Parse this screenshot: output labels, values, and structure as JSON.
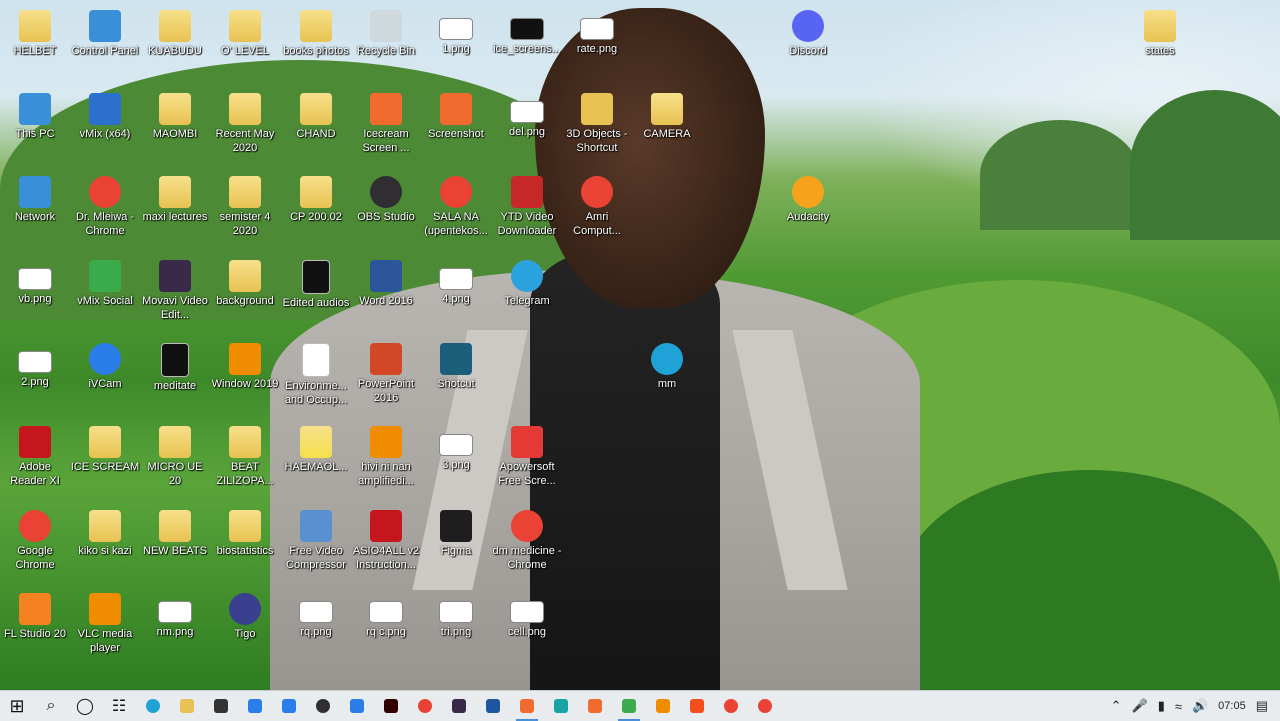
{
  "desktop": {
    "icons": [
      {
        "label": "HELBET",
        "icon": "user-folder-icon",
        "color": "#e8c252"
      },
      {
        "label": "Control Panel",
        "icon": "control-panel-icon",
        "color": "#3a8fd9"
      },
      {
        "label": "KUABUDU",
        "icon": "folder-icon",
        "color": "#e8c252"
      },
      {
        "label": "O' LEVEL",
        "icon": "folder-icon",
        "color": "#e8c252"
      },
      {
        "label": "books photos",
        "icon": "folder-icon",
        "color": "#e8c252"
      },
      {
        "label": "Recycle Bin",
        "icon": "recycle-bin-icon",
        "color": "#cfd8dc"
      },
      {
        "label": "1.png",
        "icon": "image-file-icon",
        "color": "#ffffff"
      },
      {
        "label": "ice_screens...",
        "icon": "image-file-icon",
        "color": "#111111"
      },
      {
        "label": "rate.png",
        "icon": "image-file-icon",
        "color": "#ffffff"
      },
      {
        "label": "Discord",
        "icon": "discord-icon",
        "color": "#5865f2"
      },
      {
        "label": "states",
        "icon": "folder-icon",
        "color": "#e8c252"
      },
      {
        "label": "This PC",
        "icon": "this-pc-icon",
        "color": "#3a8fd9"
      },
      {
        "label": "vMix (x64)",
        "icon": "vmix-icon",
        "color": "#2b6fcf"
      },
      {
        "label": "MAOMBI",
        "icon": "folder-icon",
        "color": "#e8c252"
      },
      {
        "label": "Recent May 2020",
        "icon": "folder-icon",
        "color": "#e8c252"
      },
      {
        "label": "CHAND",
        "icon": "folder-icon",
        "color": "#e8c252"
      },
      {
        "label": "Icecream Screen ...",
        "icon": "icecream-icon",
        "color": "#f26b2e"
      },
      {
        "label": "Screenshot",
        "icon": "screenshot-icon",
        "color": "#f26b2e"
      },
      {
        "label": "del.png",
        "icon": "image-file-icon",
        "color": "#ffffff"
      },
      {
        "label": "3D Objects - Shortcut",
        "icon": "3d-objects-icon",
        "color": "#e8c252"
      },
      {
        "label": "CAMERA",
        "icon": "folder-icon",
        "color": "#e8c252"
      },
      {
        "label": "Network",
        "icon": "network-icon",
        "color": "#3a8fd9"
      },
      {
        "label": "Dr. Mleiwa - Chrome",
        "icon": "chrome-icon",
        "color": "#ea4335"
      },
      {
        "label": "maxi lectures",
        "icon": "folder-icon",
        "color": "#e8c252"
      },
      {
        "label": "semister 4 2020",
        "icon": "folder-icon",
        "color": "#e8c252"
      },
      {
        "label": "CP 200.02",
        "icon": "folder-icon",
        "color": "#e8c252"
      },
      {
        "label": "OBS Studio",
        "icon": "obs-icon",
        "color": "#302e31"
      },
      {
        "label": "SALA NA (upentekos...",
        "icon": "chrome-icon",
        "color": "#ea4335"
      },
      {
        "label": "YTD Video Downloader",
        "icon": "ytd-icon",
        "color": "#c62828"
      },
      {
        "label": "Amri Comput...",
        "icon": "chrome-icon",
        "color": "#ea4335"
      },
      {
        "label": "Audacity",
        "icon": "audacity-icon",
        "color": "#f7a21b"
      },
      {
        "label": "vb.png",
        "icon": "image-file-icon",
        "color": "#ffffff"
      },
      {
        "label": "vMix Social",
        "icon": "vmix-social-icon",
        "color": "#3cab4b"
      },
      {
        "label": "Movavi Video Edit...",
        "icon": "movavi-icon",
        "color": "#3a2a4a"
      },
      {
        "label": "background",
        "icon": "folder-icon",
        "color": "#e8c252"
      },
      {
        "label": "Edited audios",
        "icon": "file-icon",
        "color": "#111111"
      },
      {
        "label": "Word 2016",
        "icon": "word-icon",
        "color": "#2b579a"
      },
      {
        "label": "4.png",
        "icon": "image-file-icon",
        "color": "#ffffff"
      },
      {
        "label": "Telegram",
        "icon": "telegram-icon",
        "color": "#2aa3df"
      },
      {
        "label": "2.png",
        "icon": "image-file-icon",
        "color": "#ffffff"
      },
      {
        "label": "iVCam",
        "icon": "ivcam-icon",
        "color": "#2b7de9"
      },
      {
        "label": "meditate",
        "icon": "file-icon",
        "color": "#111111"
      },
      {
        "label": "Window 2019",
        "icon": "vlc-icon",
        "color": "#f08c00"
      },
      {
        "label": "Environme... and Occup...",
        "icon": "file-icon",
        "color": "#ffffff"
      },
      {
        "label": "PowerPoint 2016",
        "icon": "powerpoint-icon",
        "color": "#d24726"
      },
      {
        "label": "Shotcut",
        "icon": "shotcut-icon",
        "color": "#1b5f7a"
      },
      {
        "label": "mm",
        "icon": "edge-icon",
        "color": "#1fa3d6"
      },
      {
        "label": "Adobe Reader XI",
        "icon": "adobe-reader-icon",
        "color": "#c4161c"
      },
      {
        "label": "ICE SCREAM",
        "icon": "folder-icon",
        "color": "#e8c252"
      },
      {
        "label": "MICRO UE 20",
        "icon": "folder-icon",
        "color": "#e8c252"
      },
      {
        "label": "BEAT ZILIZOPA...",
        "icon": "folder-icon",
        "color": "#e8c252"
      },
      {
        "label": "HAEMAOL...",
        "icon": "folder-icon",
        "color": "#f5e04a"
      },
      {
        "label": "hivi ni nan amplifiedi...",
        "icon": "vlc-icon",
        "color": "#f08c00"
      },
      {
        "label": "3.png",
        "icon": "image-file-icon",
        "color": "#ffffff"
      },
      {
        "label": "Apowersoft Free Scre...",
        "icon": "apowersoft-icon",
        "color": "#e53935"
      },
      {
        "label": "Google Chrome",
        "icon": "chrome-icon",
        "color": "#ea4335"
      },
      {
        "label": "kiko si kazi",
        "icon": "folder-icon",
        "color": "#e8c252"
      },
      {
        "label": "NEW BEATS",
        "icon": "folder-icon",
        "color": "#e8c252"
      },
      {
        "label": "biostatistics",
        "icon": "folder-icon",
        "color": "#e8c252"
      },
      {
        "label": "Free Video Compressor",
        "icon": "video-compressor-icon",
        "color": "#5a8fd0"
      },
      {
        "label": "ASIO4ALL v2 Instruction...",
        "icon": "pdf-icon",
        "color": "#c4161c"
      },
      {
        "label": "Figma",
        "icon": "figma-icon",
        "color": "#1e1e1e"
      },
      {
        "label": "dm medicine - Chrome",
        "icon": "chrome-icon",
        "color": "#ea4335"
      },
      {
        "label": "FL Studio 20",
        "icon": "fl-studio-icon",
        "color": "#f58220"
      },
      {
        "label": "VLC media player",
        "icon": "vlc-icon",
        "color": "#f08c00"
      },
      {
        "label": "nm.png",
        "icon": "image-file-icon",
        "color": "#ffffff"
      },
      {
        "label": "Tigo",
        "icon": "tigo-icon",
        "color": "#3a3f8f"
      },
      {
        "label": "rq.png",
        "icon": "image-file-icon",
        "color": "#ffffff"
      },
      {
        "label": "rq c.png",
        "icon": "image-file-icon",
        "color": "#ffffff"
      },
      {
        "label": "tri.png",
        "icon": "image-file-icon",
        "color": "#ffffff"
      },
      {
        "label": "cell.png",
        "icon": "image-file-icon",
        "color": "#ffffff"
      }
    ]
  },
  "taskbar": {
    "items": [
      {
        "icon": "windows-start-icon",
        "color": "#111111",
        "active": false
      },
      {
        "icon": "search-icon",
        "color": "#111111",
        "active": false
      },
      {
        "icon": "cortana-icon",
        "color": "#111111",
        "active": false
      },
      {
        "icon": "task-view-icon",
        "color": "#111111",
        "active": false
      },
      {
        "icon": "edge-icon",
        "color": "#1fa3d6",
        "active": false
      },
      {
        "icon": "file-explorer-icon",
        "color": "#e8c252",
        "active": false
      },
      {
        "icon": "store-icon",
        "color": "#333333",
        "active": false
      },
      {
        "icon": "mail-icon",
        "color": "#2b7de9",
        "active": false
      },
      {
        "icon": "screen-icon",
        "color": "#2b7de9",
        "active": false
      },
      {
        "icon": "obs-icon",
        "color": "#302e31",
        "active": false
      },
      {
        "icon": "ivcam-icon",
        "color": "#2b7de9",
        "active": false
      },
      {
        "icon": "illustrator-icon",
        "color": "#330000",
        "active": false
      },
      {
        "icon": "chrome-icon",
        "color": "#ea4335",
        "active": false
      },
      {
        "icon": "movavi-icon",
        "color": "#3a2a4a",
        "active": false
      },
      {
        "icon": "mail-send-icon",
        "color": "#1e56a0",
        "active": false
      },
      {
        "icon": "icecream-icon",
        "color": "#f26b2e",
        "active": true
      },
      {
        "icon": "apowersoft-icon",
        "color": "#1aa3a3",
        "active": false
      },
      {
        "icon": "screenshot-icon",
        "color": "#f26b2e",
        "active": false
      },
      {
        "icon": "vmix-social-icon",
        "color": "#3cab4b",
        "active": true
      },
      {
        "icon": "vlc-icon",
        "color": "#f08c00",
        "active": false
      },
      {
        "icon": "figma-icon",
        "color": "#f24e1e",
        "active": false
      },
      {
        "icon": "chrome-icon",
        "color": "#ea4335",
        "active": false
      },
      {
        "icon": "chrome-icon",
        "color": "#ea4335",
        "active": false
      }
    ],
    "tray": {
      "time": "07:05"
    }
  }
}
